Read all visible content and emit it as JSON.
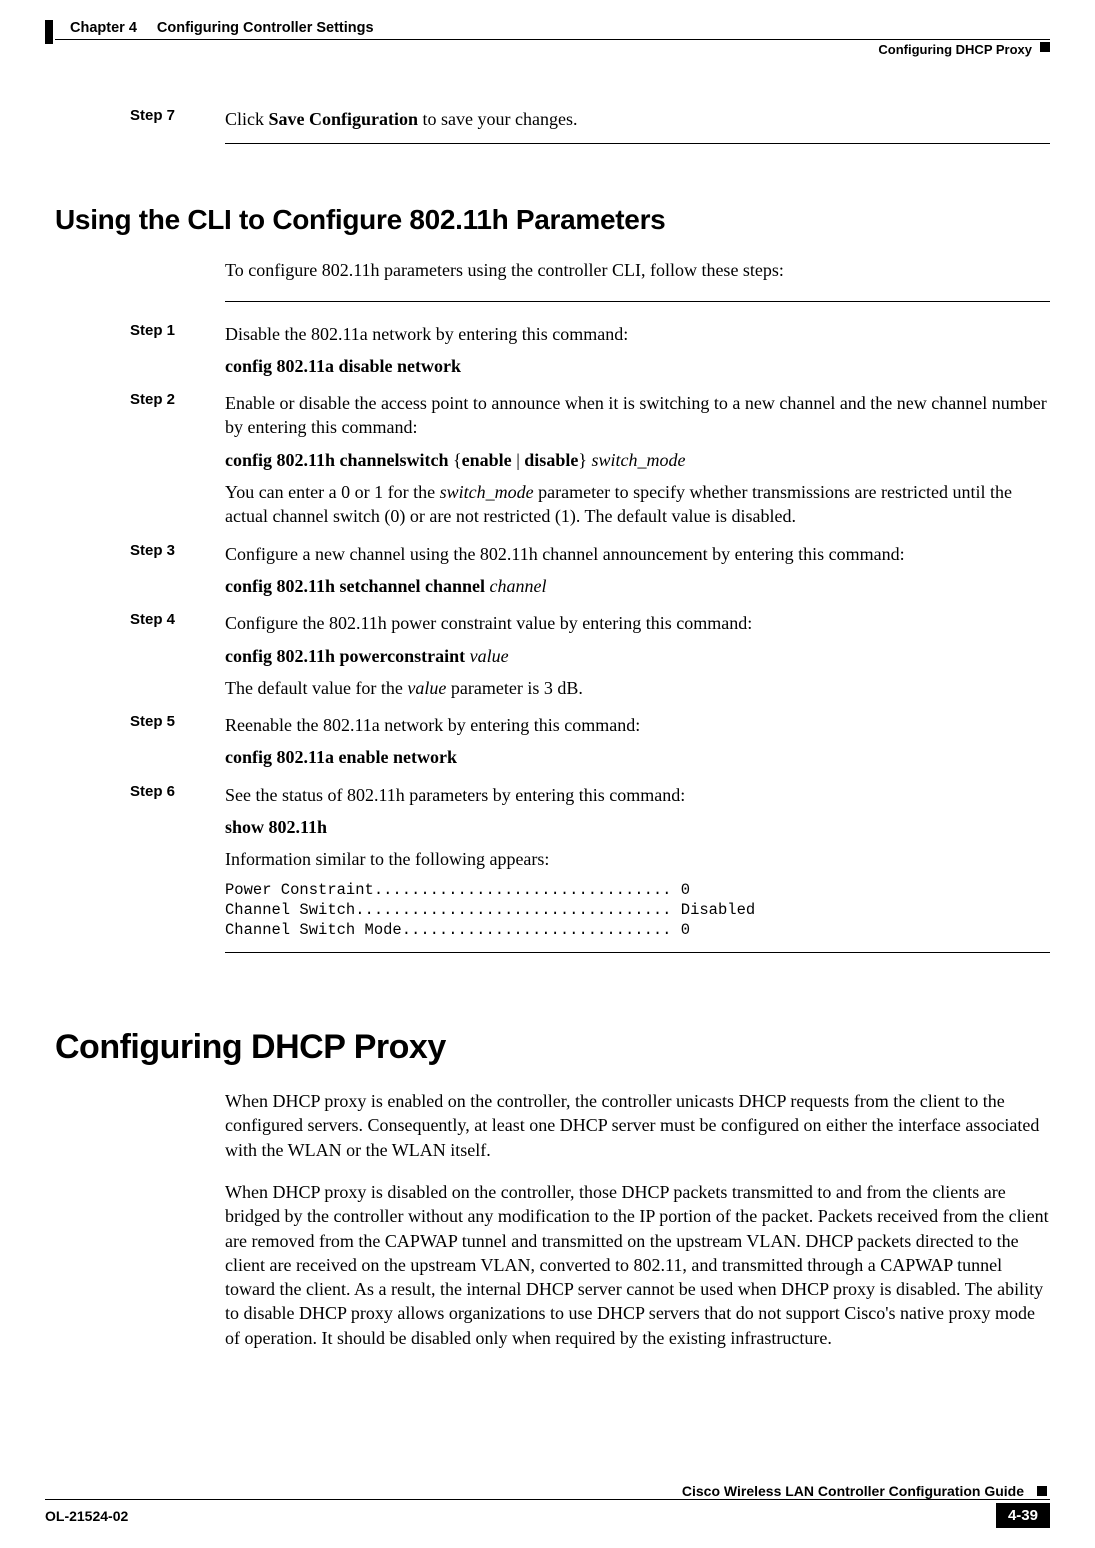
{
  "header": {
    "chapter_label": "Chapter 4",
    "chapter_title": "Configuring Controller Settings",
    "section_right": "Configuring DHCP Proxy"
  },
  "top_step": {
    "label": "Step 7",
    "text_before": "Click ",
    "text_bold": "Save Configuration",
    "text_after": " to save your changes."
  },
  "section_cli": {
    "title": "Using the CLI to Configure 802.11h Parameters",
    "intro": "To configure 802.11h parameters using the controller CLI, follow these steps:",
    "steps": {
      "s1": {
        "label": "Step 1",
        "line1": "Disable the 802.11a network by entering this command:",
        "cmd": "config 802.11a disable network"
      },
      "s2": {
        "label": "Step 2",
        "line1": "Enable or disable the access point to announce when it is switching to a new channel and the new channel number by entering this command:",
        "cmd_pre": "config 802.11h channelswitch ",
        "cmd_brace1": "{",
        "cmd_opt1": "enable",
        "cmd_pipe": " | ",
        "cmd_opt2": "disable",
        "cmd_brace2": "}",
        "cmd_param": " switch_mode",
        "note_pre": "You can enter a 0 or 1 for the ",
        "note_italic": "switch_mode",
        "note_after": " parameter to specify whether transmissions are restricted until the actual channel switch (0) or are not restricted (1). The default value is disabled."
      },
      "s3": {
        "label": "Step 3",
        "line1": "Configure a new channel using the 802.11h channel announcement by entering this command:",
        "cmd_pre": "config 802.11h setchannel channel ",
        "cmd_param": "channel"
      },
      "s4": {
        "label": "Step 4",
        "line1": "Configure the 802.11h power constraint value by entering this command:",
        "cmd_pre": "config 802.11h powerconstraint ",
        "cmd_param": "value",
        "note_pre": "The default value for the ",
        "note_italic": "value",
        "note_after": " parameter is 3 dB."
      },
      "s5": {
        "label": "Step 5",
        "line1": "Reenable the 802.11a network by entering this command:",
        "cmd": "config 802.11a enable network"
      },
      "s6": {
        "label": "Step 6",
        "line1": "See the status of 802.11h parameters by entering this command:",
        "cmd": "show 802.11h",
        "note": "Information similar to the following appears:",
        "output": "Power Constraint................................ 0\nChannel Switch.................................. Disabled\nChannel Switch Mode............................. 0"
      }
    }
  },
  "section_dhcp": {
    "title": "Configuring DHCP Proxy",
    "p1": "When DHCP proxy is enabled on the controller, the controller unicasts DHCP requests from the client to the configured servers. Consequently, at least one DHCP server must be configured on either the interface associated with the WLAN or the WLAN itself.",
    "p2": "When DHCP proxy is disabled on the controller, those DHCP packets transmitted to and from the clients are bridged by the controller without any modification to the IP portion of the packet. Packets received from the client are removed from the CAPWAP tunnel and transmitted on the upstream VLAN. DHCP packets directed to the client are received on the upstream VLAN, converted to 802.11, and transmitted through a CAPWAP tunnel toward the client. As a result, the internal DHCP server cannot be used when DHCP proxy is disabled. The ability to disable DHCP proxy allows organizations to use DHCP servers that do not support Cisco's native proxy mode of operation. It should be disabled only when required by the existing infrastructure."
  },
  "footer": {
    "guide_title": "Cisco Wireless LAN Controller Configuration Guide",
    "doc_id": "OL-21524-02",
    "page_num": "4-39"
  }
}
